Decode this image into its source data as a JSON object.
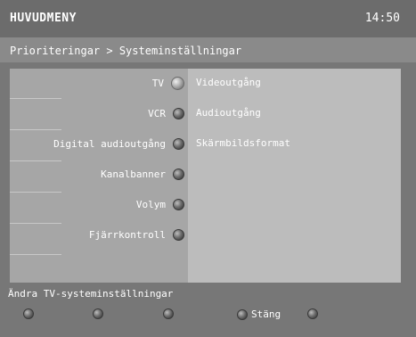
{
  "header": {
    "title": "HUVUDMENY",
    "clock": "14:50"
  },
  "breadcrumb": "Prioriteringar > Systeminställningar",
  "menu": {
    "items": [
      {
        "label": "TV"
      },
      {
        "label": "VCR"
      },
      {
        "label": "Digital audioutgång"
      },
      {
        "label": "Kanalbanner"
      },
      {
        "label": "Volym"
      },
      {
        "label": "Fjärrkontroll"
      }
    ],
    "submenu": [
      "Videoutgång",
      "Audioutgång",
      "Skärmbildsformat"
    ]
  },
  "footer": {
    "status": "Ändra TV-systeminställningar",
    "buttons": [
      "",
      "",
      "",
      "Stäng",
      ""
    ]
  }
}
